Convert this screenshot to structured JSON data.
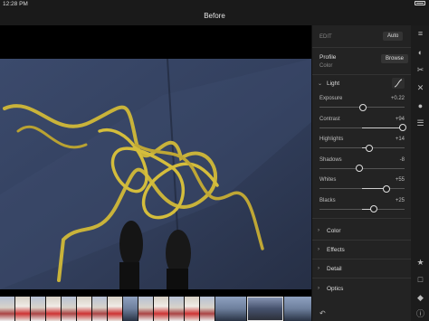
{
  "status": {
    "time": "12:28 PM",
    "battery_level": 0.8
  },
  "header": {
    "title": "Before"
  },
  "panel": {
    "edit_label": "EDIT",
    "auto_label": "Auto",
    "profile_label": "Profile",
    "profile_value": "Color",
    "browse_label": "Browse",
    "light": {
      "title": "Light",
      "sliders": [
        {
          "label": "Exposure",
          "value": "+0.22",
          "position": 0.5
        },
        {
          "label": "Contrast",
          "value": "+94",
          "position": 0.97
        },
        {
          "label": "Highlights",
          "value": "+14",
          "position": 0.57
        },
        {
          "label": "Shadows",
          "value": "-8",
          "position": 0.46
        },
        {
          "label": "Whites",
          "value": "+55",
          "position": 0.78
        },
        {
          "label": "Blacks",
          "value": "+25",
          "position": 0.63
        }
      ]
    },
    "sections": [
      {
        "label": "Color"
      },
      {
        "label": "Effects"
      },
      {
        "label": "Detail"
      },
      {
        "label": "Optics"
      }
    ]
  },
  "icons": {
    "rail": [
      "sliders-icon",
      "presets-icon",
      "crop-icon",
      "healing-icon",
      "selective-icon",
      "versions-icon",
      "star-icon",
      "comment-icon",
      "tag-icon",
      "info-icon"
    ]
  }
}
